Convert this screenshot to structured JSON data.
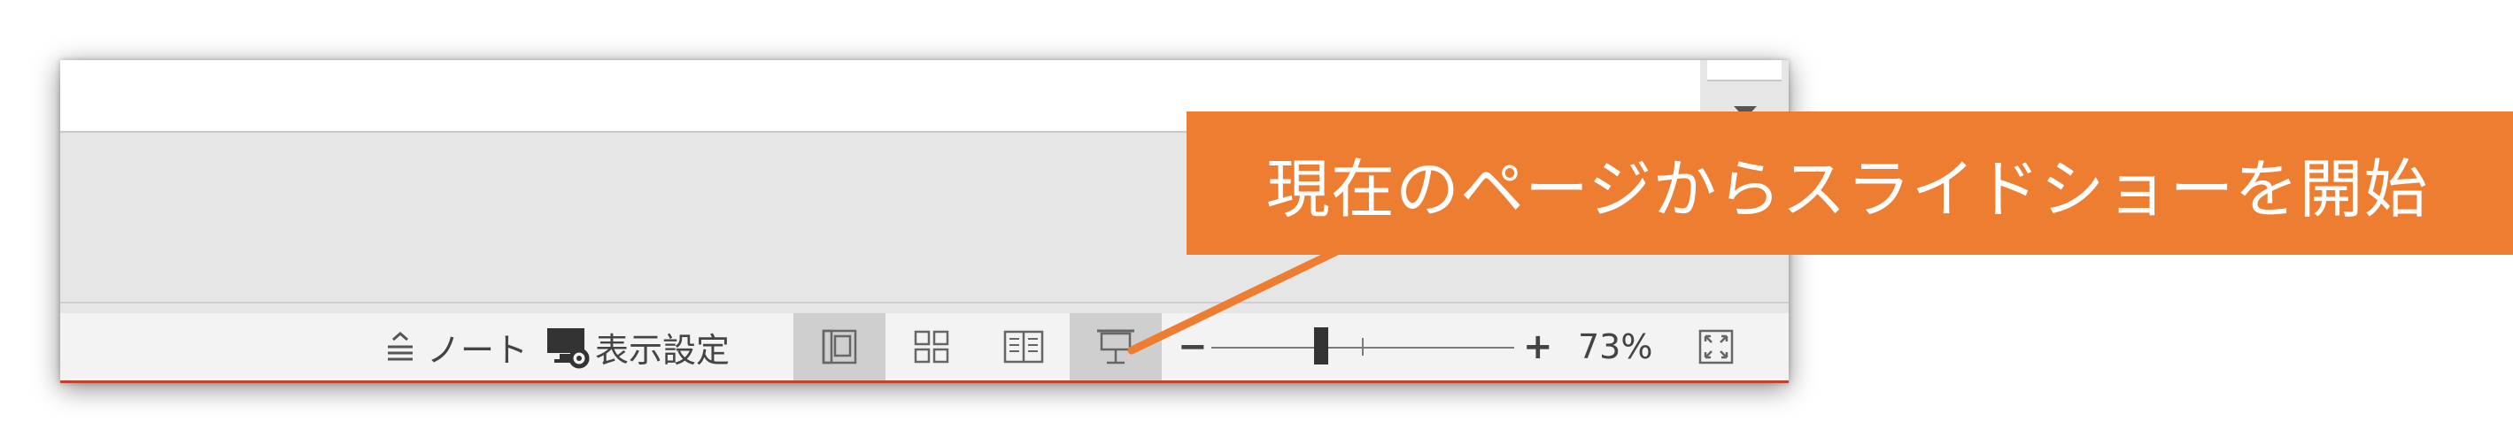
{
  "statusbar": {
    "notes_label": "ノート",
    "display_settings_label": "表示設定",
    "zoom_minus": "−",
    "zoom_plus": "+",
    "zoom_percent": "73%",
    "zoom_level": 0.73
  },
  "callout": {
    "text": "現在のページからスライドショーを開始",
    "color": "#ed7d31"
  },
  "icons": [
    "notes-icon",
    "display-settings-icon",
    "normal-view-icon",
    "slide-sorter-icon",
    "reading-view-icon",
    "slideshow-icon",
    "fit-to-window-icon"
  ],
  "colors": {
    "window_border": "#c4412a",
    "active_view": "#cfcfcf"
  }
}
